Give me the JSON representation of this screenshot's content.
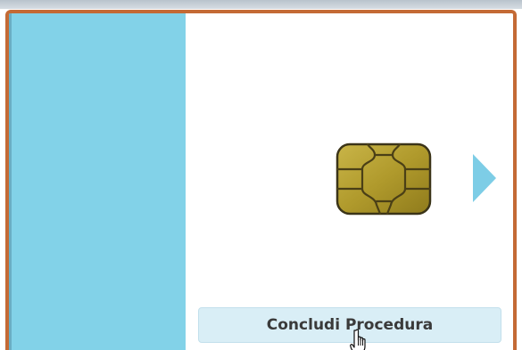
{
  "screen": {
    "finish_button_label": "Concludi Procedura",
    "colors": {
      "frame_border": "#c46a35",
      "side_panel": "#82d2e8",
      "arrow": "#7dcde6",
      "chip_gold": "#b8a235",
      "button_bg": "#d9eef6"
    },
    "icons": {
      "chip": "smart-card-chip-icon",
      "arrow": "arrow-right-icon",
      "cursor": "hand-pointer-icon"
    }
  }
}
